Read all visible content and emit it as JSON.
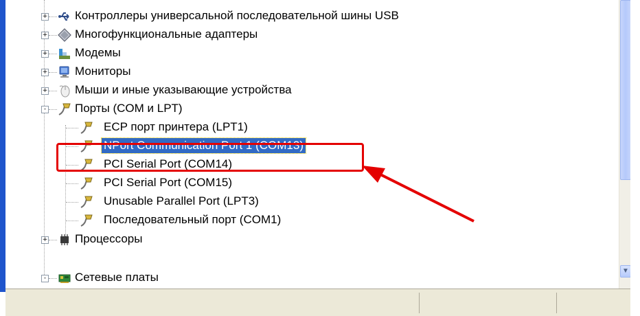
{
  "tree": {
    "items": [
      {
        "label": "Контроллеры универсальной последовательной шины USB",
        "icon": "usb-icon",
        "expander": "+"
      },
      {
        "label": "Многофункциональные адаптеры",
        "icon": "adapter-icon",
        "expander": "+"
      },
      {
        "label": "Модемы",
        "icon": "modem-icon",
        "expander": "+"
      },
      {
        "label": "Мониторы",
        "icon": "monitor-icon",
        "expander": "+"
      },
      {
        "label": "Мыши и иные указывающие устройства",
        "icon": "mouse-icon",
        "expander": "+"
      },
      {
        "label": "Порты (COM и LPT)",
        "icon": "port-icon",
        "expander": "-"
      },
      {
        "label": "ECP порт принтера (LPT1)",
        "icon": "port-icon"
      },
      {
        "label": "NPort Communication Port 1 (COM13)",
        "icon": "port-icon",
        "selected": true
      },
      {
        "label": "PCI Serial Port (COM14)",
        "icon": "port-icon"
      },
      {
        "label": "PCI Serial Port (COM15)",
        "icon": "port-icon"
      },
      {
        "label": "Unusable Parallel Port (LPT3)",
        "icon": "port-icon"
      },
      {
        "label": "Последовательный порт (COM1)",
        "icon": "port-icon"
      },
      {
        "label": "Процессоры",
        "icon": "cpu-icon",
        "expander": "+"
      },
      {
        "label": "Сетевые платы",
        "icon": "network-card-icon",
        "expander": "-"
      }
    ]
  },
  "colors": {
    "selection": "#316ac5",
    "annotation": "#e40000"
  }
}
